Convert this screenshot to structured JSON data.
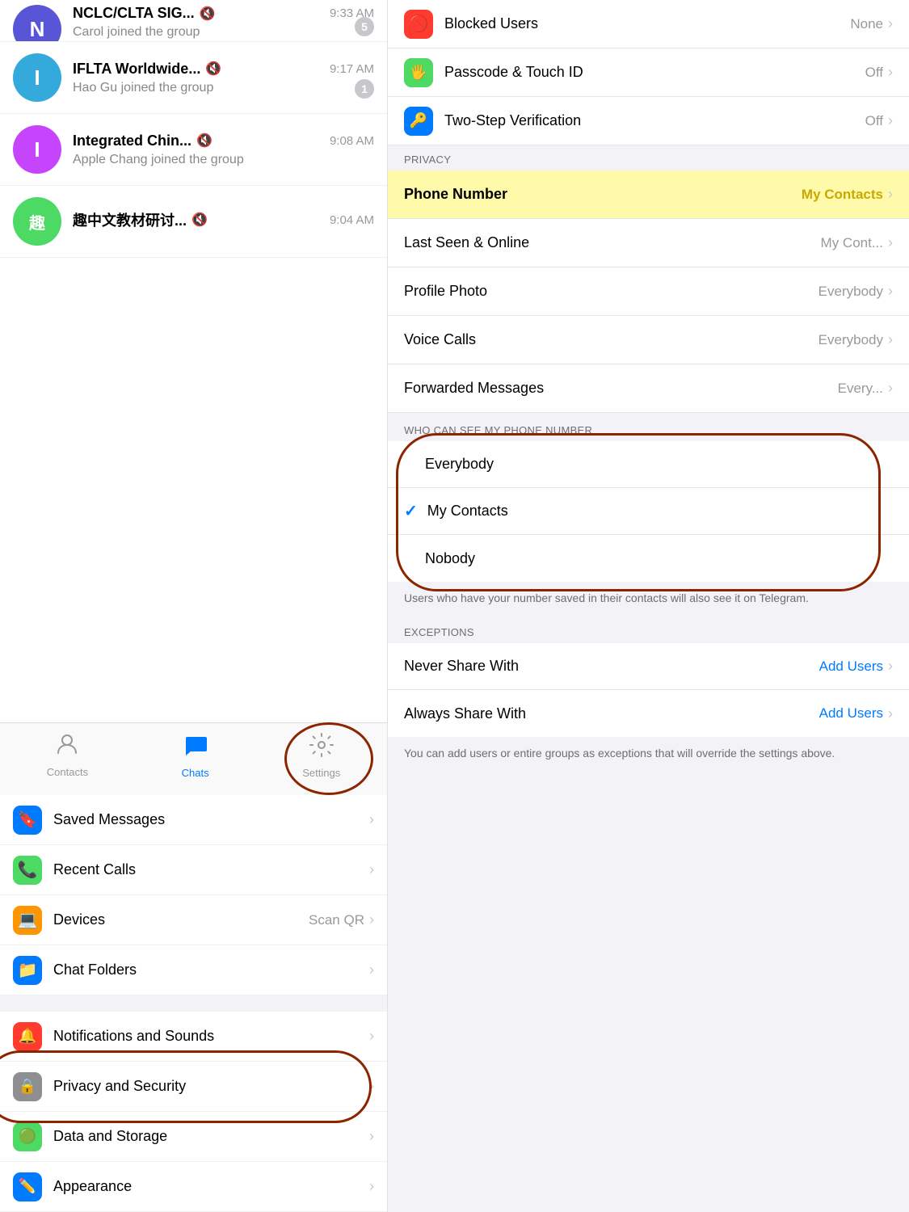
{
  "left": {
    "chats": [
      {
        "id": "nclc",
        "initials": "N",
        "avatar_color": "#5856d6",
        "name": "NCLC/CLTA SIG...",
        "muted": true,
        "time": "9:33 AM",
        "preview": "Carol joined the group",
        "badge": "5"
      },
      {
        "id": "iflta",
        "initials": "I",
        "avatar_color": "#34aadc",
        "name": "IFLTA Worldwide...",
        "muted": true,
        "time": "9:17 AM",
        "preview": "Hao Gu joined the group",
        "badge": "1"
      },
      {
        "id": "integrated",
        "initials": "I",
        "avatar_color": "#c644fc",
        "name": "Integrated Chin...",
        "muted": true,
        "time": "9:08 AM",
        "preview": "Apple Chang joined the group",
        "badge": null
      },
      {
        "id": "qu",
        "initials": "趣",
        "avatar_color": "#4cd964",
        "name": "趣中文教材研讨...",
        "muted": true,
        "time": "9:04 AM",
        "preview": "",
        "badge": null
      }
    ],
    "tabs": [
      {
        "id": "contacts",
        "label": "Contacts",
        "icon": "👤",
        "active": false
      },
      {
        "id": "chats",
        "label": "Chats",
        "icon": "💬",
        "active": true
      },
      {
        "id": "settings",
        "label": "Settings",
        "icon": "⚙️",
        "active": false
      }
    ],
    "settings_items": [
      {
        "id": "saved",
        "icon": "🔖",
        "icon_bg": "#007aff",
        "label": "Saved Messages",
        "value": "",
        "show_chevron": true
      },
      {
        "id": "recent_calls",
        "icon": "📞",
        "icon_bg": "#4cd964",
        "label": "Recent Calls",
        "value": "",
        "show_chevron": true
      },
      {
        "id": "devices",
        "icon": "💻",
        "icon_bg": "#ff9500",
        "label": "Devices",
        "value": "Scan QR",
        "show_chevron": true
      },
      {
        "id": "chat_folders",
        "icon": "📁",
        "icon_bg": "#007aff",
        "label": "Chat Folders",
        "value": "",
        "show_chevron": true
      },
      {
        "id": "notifications",
        "icon": "🔔",
        "icon_bg": "#ff3b30",
        "label": "Notifications and Sounds",
        "value": "",
        "show_chevron": true
      },
      {
        "id": "privacy",
        "icon": "🔒",
        "icon_bg": "#8e8e93",
        "label": "Privacy and Security",
        "value": "",
        "show_chevron": true
      },
      {
        "id": "data",
        "icon": "🟢",
        "icon_bg": "#4cd964",
        "label": "Data and Storage",
        "value": "",
        "show_chevron": true
      },
      {
        "id": "appearance",
        "icon": "✏️",
        "icon_bg": "#007aff",
        "label": "Appearance",
        "value": "",
        "show_chevron": true
      }
    ]
  },
  "right": {
    "security_items": [
      {
        "id": "blocked",
        "icon": "🚫",
        "icon_bg": "#ff3b30",
        "label": "Blocked Users",
        "value": "None",
        "show_chevron": true
      },
      {
        "id": "passcode",
        "icon": "🖐",
        "icon_bg": "#4cd964",
        "label": "Passcode & Touch ID",
        "value": "Off",
        "show_chevron": true
      },
      {
        "id": "two_step",
        "icon": "🔑",
        "icon_bg": "#007aff",
        "label": "Two-Step Verification",
        "value": "Off",
        "show_chevron": true
      }
    ],
    "privacy_header": "PRIVACY",
    "privacy_items": [
      {
        "id": "phone",
        "label": "Phone Number",
        "value": "My Contacts",
        "show_chevron": true,
        "highlighted": true
      },
      {
        "id": "last_seen",
        "label": "Last Seen & Online",
        "value": "My Cont...",
        "show_chevron": true
      },
      {
        "id": "profile_photo",
        "label": "Profile Photo",
        "value": "Everybody",
        "show_chevron": true
      },
      {
        "id": "voice_calls",
        "label": "Voice Calls",
        "value": "Everybody",
        "show_chevron": true
      },
      {
        "id": "forwarded",
        "label": "Forwarded Messages",
        "value": "Every...",
        "show_chevron": true
      }
    ],
    "who_can_see_header": "WHO CAN SEE MY PHONE NUMBER",
    "options": [
      {
        "id": "everybody",
        "label": "Everybody",
        "selected": false
      },
      {
        "id": "my_contacts",
        "label": "My Contacts",
        "selected": true
      },
      {
        "id": "nobody",
        "label": "Nobody",
        "selected": false
      }
    ],
    "info_text": "Users who have your number saved in their contacts will also see it on Telegram.",
    "exceptions_header": "EXCEPTIONS",
    "exceptions": [
      {
        "id": "never_share",
        "label": "Never Share With",
        "value": "Add Users",
        "show_chevron": true
      },
      {
        "id": "always_share",
        "label": "Always Share With",
        "value": "Add Users",
        "show_chevron": true
      }
    ],
    "bottom_info": "You can add users or entire groups as exceptions that will override the settings above."
  }
}
